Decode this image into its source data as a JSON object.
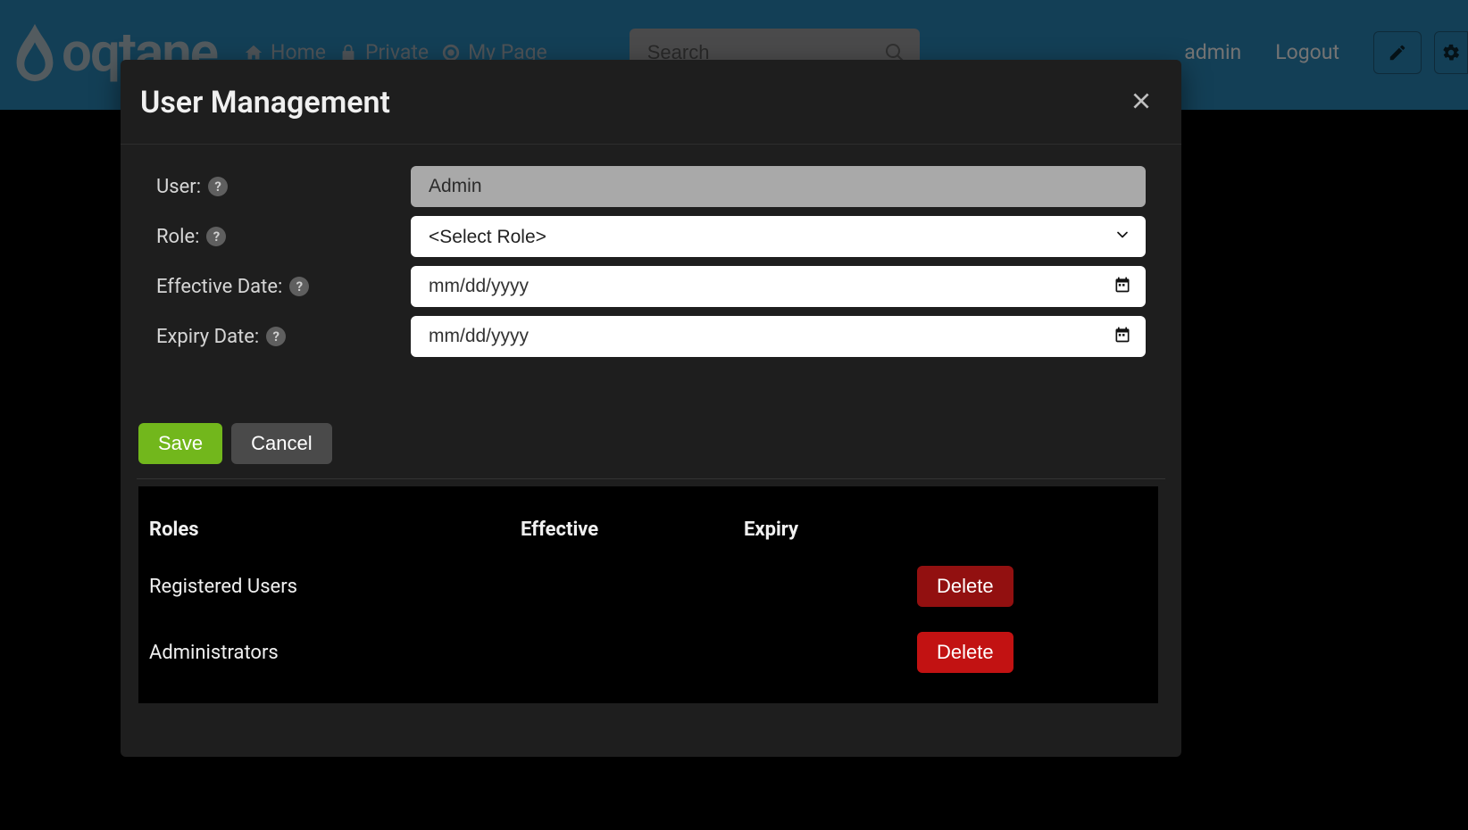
{
  "brand": {
    "name": "oqtane"
  },
  "nav": {
    "items": [
      {
        "label": "Home",
        "icon": "home-icon"
      },
      {
        "label": "Private",
        "icon": "lock-icon"
      },
      {
        "label": "My Page",
        "icon": "target-icon"
      }
    ]
  },
  "search": {
    "placeholder": "Search"
  },
  "user_menu": {
    "username": "admin",
    "logout": "Logout"
  },
  "modal": {
    "title": "User Management",
    "fields": {
      "user": {
        "label": "User:",
        "value": "Admin"
      },
      "role": {
        "label": "Role:",
        "placeholder": "<Select Role>"
      },
      "effective_date": {
        "label": "Effective Date:",
        "placeholder": "mm/dd/yyyy"
      },
      "expiry_date": {
        "label": "Expiry Date:",
        "placeholder": "mm/dd/yyyy"
      }
    },
    "buttons": {
      "save": "Save",
      "cancel": "Cancel",
      "delete": "Delete"
    },
    "table": {
      "headers": {
        "roles": "Roles",
        "effective": "Effective",
        "expiry": "Expiry"
      },
      "rows": [
        {
          "role": "Registered Users",
          "effective": "",
          "expiry": ""
        },
        {
          "role": "Administrators",
          "effective": "",
          "expiry": ""
        }
      ]
    }
  },
  "colors": {
    "topbar": "#2c8cbf",
    "save": "#72b71c",
    "delete": "#c21212",
    "modal_bg": "#1e1e1e"
  }
}
